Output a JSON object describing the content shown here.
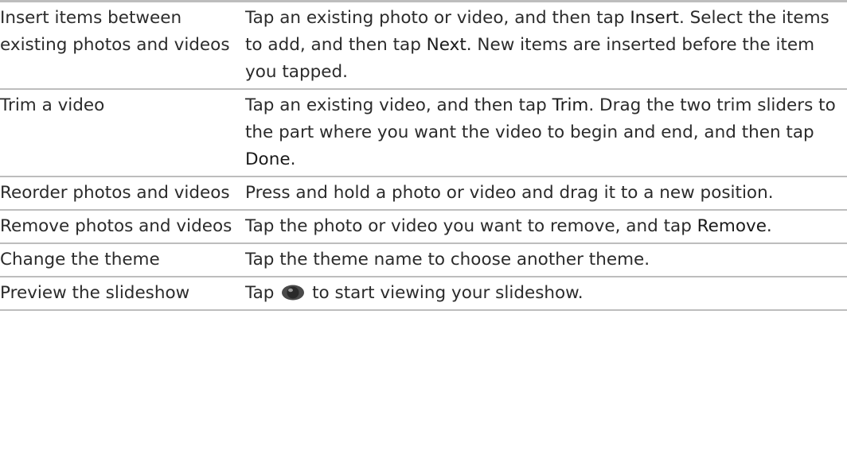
{
  "rows": [
    {
      "feature": "Insert items between existing photos and videos",
      "description": [
        {
          "text": "Tap an existing photo or video, and then tap "
        },
        {
          "text": "Insert",
          "emphasis": true
        },
        {
          "text": ". Select the items to add, and then tap "
        },
        {
          "text": "Next",
          "emphasis": true
        },
        {
          "text": ". New items are inserted before the item you tapped."
        }
      ]
    },
    {
      "feature": "Trim a video",
      "description": [
        {
          "text": "Tap an existing video, and then tap "
        },
        {
          "text": "Trim",
          "emphasis": true
        },
        {
          "text": ". Drag the two trim sliders to the part where you want the video to begin and end, and then tap "
        },
        {
          "text": "Done",
          "emphasis": true
        },
        {
          "text": "."
        }
      ]
    },
    {
      "feature": "Reorder photos and videos",
      "description": [
        {
          "text": "Press and hold a photo or video and drag it to a new position."
        }
      ]
    },
    {
      "feature": "Remove photos and videos",
      "description": [
        {
          "text": "Tap the photo or video you want to remove, and tap "
        },
        {
          "text": "Remove",
          "emphasis": true
        },
        {
          "text": "."
        }
      ]
    },
    {
      "feature": "Change the theme",
      "description": [
        {
          "text": "Tap the theme name to choose another theme."
        }
      ]
    },
    {
      "feature": "Preview the slideshow",
      "description": [
        {
          "text": "Tap "
        },
        {
          "icon": "eye-icon"
        },
        {
          "text": " to start viewing your slideshow."
        }
      ]
    }
  ],
  "colors": {
    "rule": "#bdbdbd",
    "text": "#2b2b2b",
    "icon": "#4a4a4a"
  }
}
